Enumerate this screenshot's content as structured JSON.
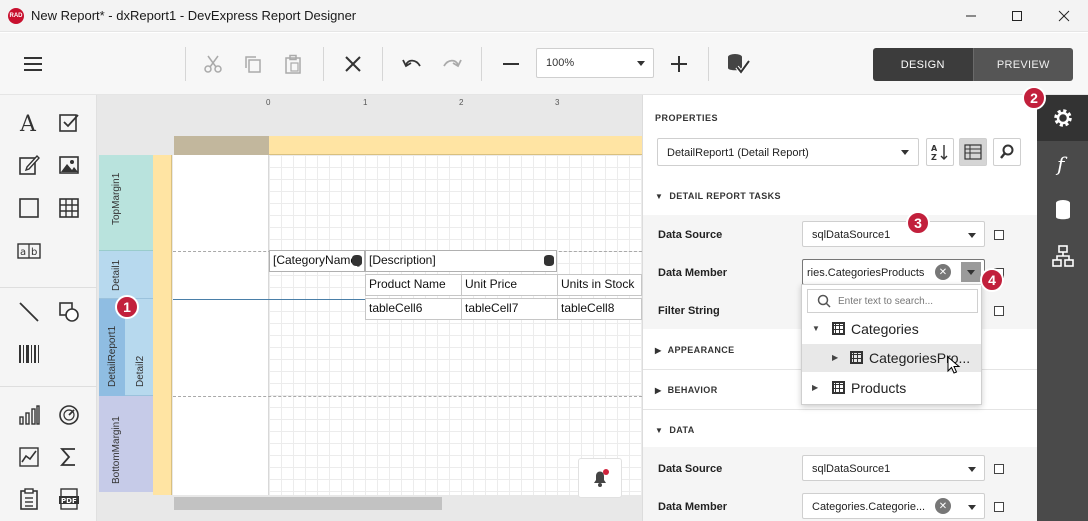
{
  "window": {
    "logo_text": "RAD",
    "title": "New Report* - dxReport1 - DevExpress Report Designer"
  },
  "toolbar": {
    "zoom_value": "100%",
    "design_label": "DESIGN",
    "preview_label": "PREVIEW"
  },
  "ruler": {
    "marks": [
      "0",
      "1",
      "2",
      "3"
    ]
  },
  "bands": {
    "top_margin": "TopMargin1",
    "detail1": "Detail1",
    "detail_report": "DetailReport1",
    "detail2": "Detail2",
    "bottom_margin": "BottomMargin1"
  },
  "cells": {
    "category_name": "[CategoryName]",
    "description": "[Description]",
    "product_name": "Product Name",
    "unit_price": "Unit Price",
    "units_in_stock": "Units in Stock",
    "cell6": "tableCell6",
    "cell7": "tableCell7",
    "cell8": "tableCell8"
  },
  "badges": [
    "1",
    "2",
    "3",
    "4"
  ],
  "properties": {
    "title": "PROPERTIES",
    "selected_object": "DetailReport1 (Detail Report)",
    "tasks_section": "DETAIL REPORT TASKS",
    "appearance_section": "APPEARANCE",
    "behavior_section": "BEHAVIOR",
    "data_section": "DATA",
    "tasks": {
      "data_source_label": "Data Source",
      "data_source_value": "sqlDataSource1",
      "data_member_label": "Data Member",
      "data_member_value": "ries.CategoriesProducts",
      "filter_string_label": "Filter String"
    },
    "data": {
      "data_source_label": "Data Source",
      "data_source_value": "sqlDataSource1",
      "data_member_label": "Data Member",
      "data_member_value": "Categories.Categorie..."
    }
  },
  "popup": {
    "search_placeholder": "Enter text to search...",
    "items": [
      "Categories",
      "CategoriesPro...",
      "Products"
    ]
  },
  "colors": {
    "accent_badge": "#c2203c",
    "band_top_margin": "#b9e3dd",
    "band_detail": "#b7d9ee",
    "band_detail_report": "#8fbde2",
    "band_bottom_margin": "#c6cbe8"
  }
}
